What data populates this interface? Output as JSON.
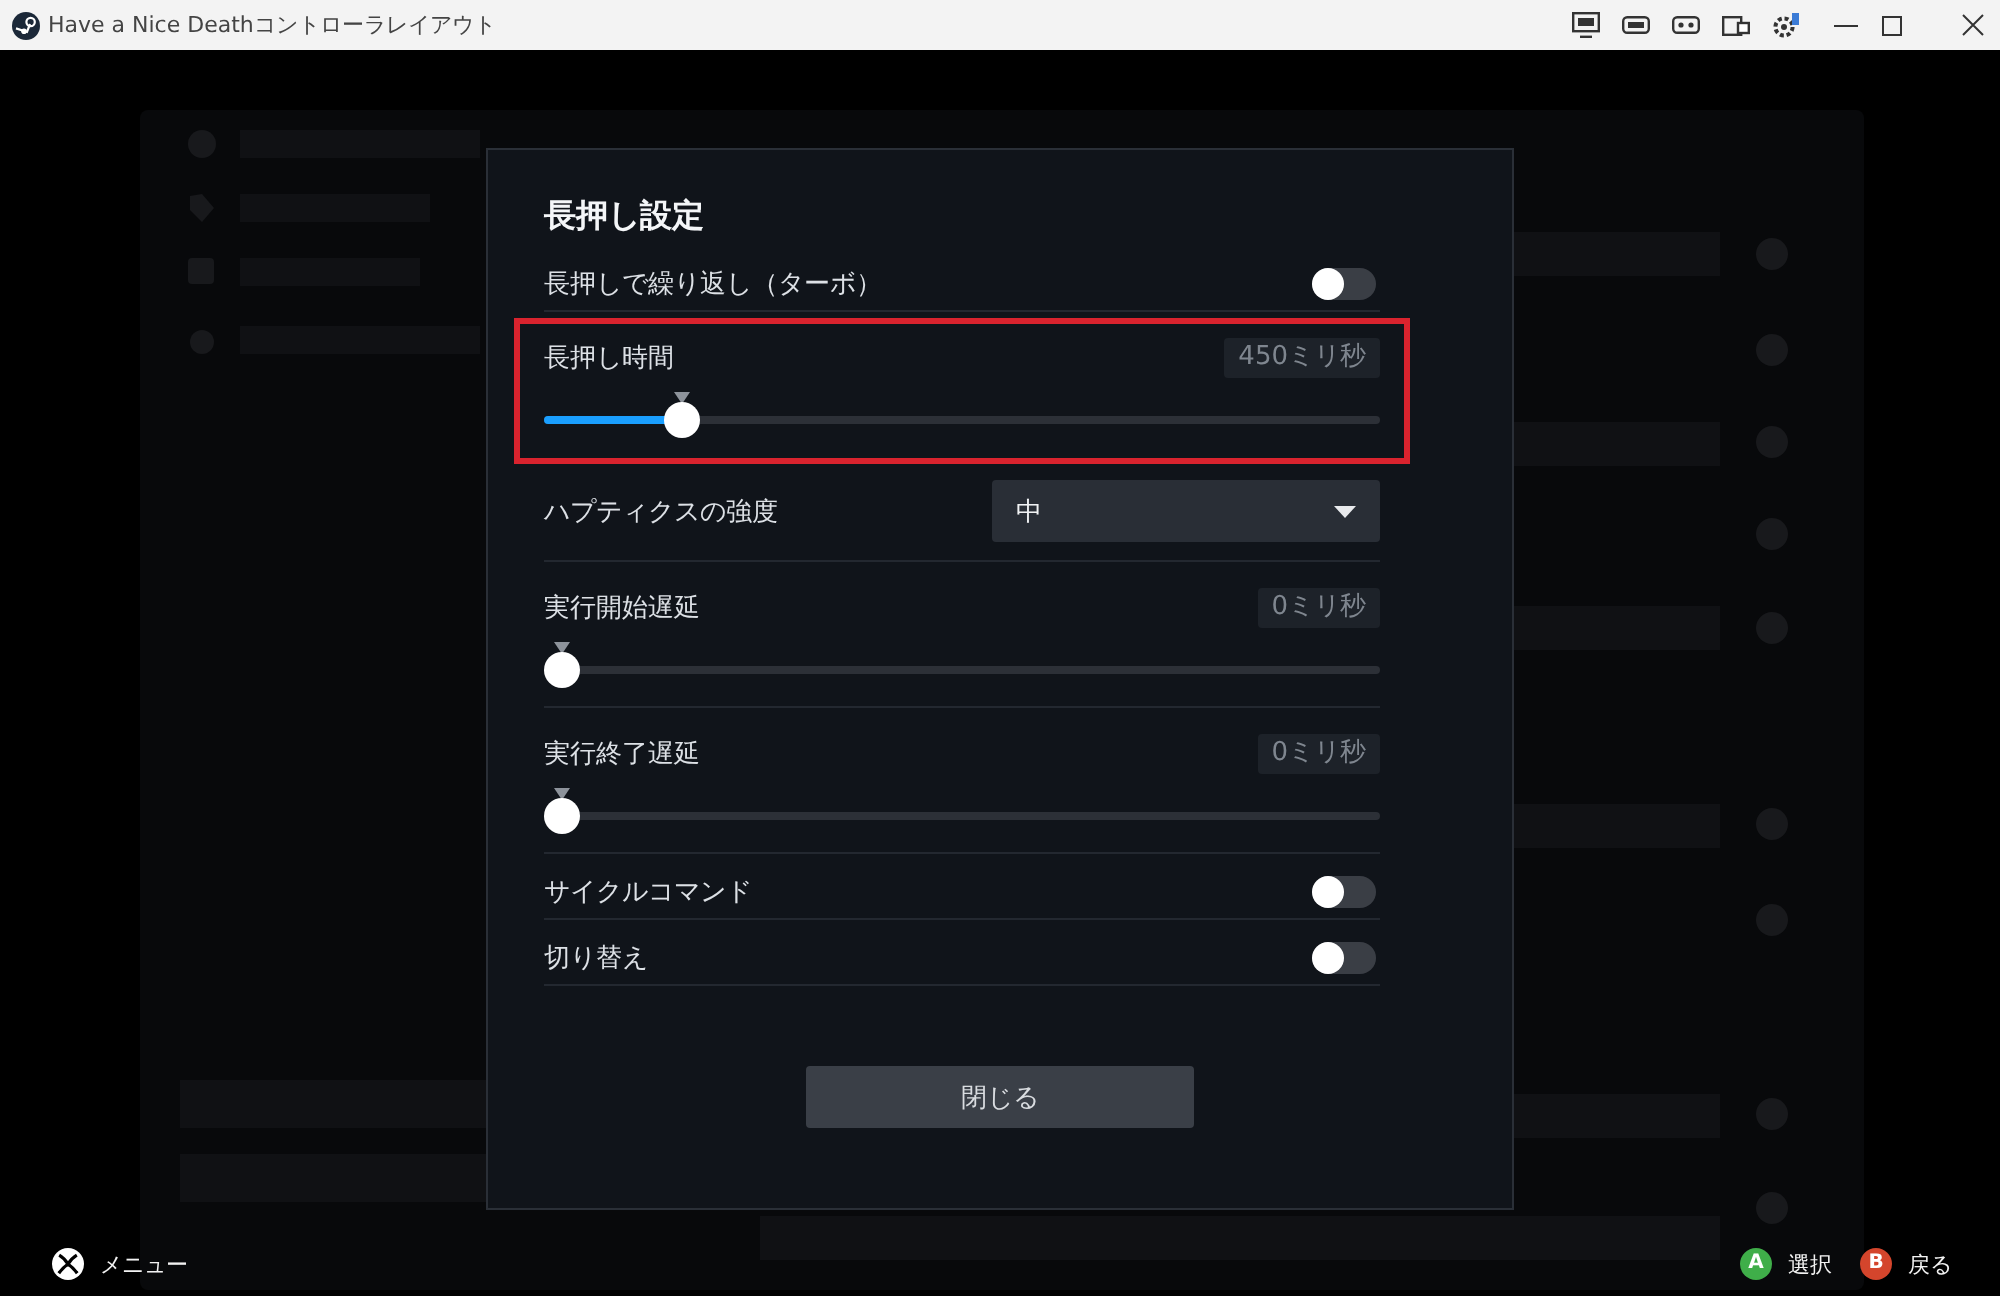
{
  "window": {
    "title": "Have a Nice Deathコントローラレイアウト"
  },
  "dialog": {
    "title": "長押し設定",
    "settings": [
      {
        "kind": "toggle",
        "label": "長押しで繰り返し（ターボ）",
        "on": false,
        "highlighted": false
      },
      {
        "kind": "slider",
        "label": "長押し時間",
        "reading": "450ミリ秒",
        "level": 0.15,
        "highlighted": true
      },
      {
        "kind": "dropdown",
        "label": "ハプティクスの強度",
        "value": "中",
        "highlighted": false
      },
      {
        "kind": "slider",
        "label": "実行開始遅延",
        "reading": "0ミリ秒",
        "level": 0,
        "highlighted": false
      },
      {
        "kind": "slider",
        "label": "実行終了遅延",
        "reading": "0ミリ秒",
        "level": 0,
        "highlighted": false
      },
      {
        "kind": "toggle",
        "label": "サイクルコマンド",
        "on": false,
        "highlighted": false
      },
      {
        "kind": "toggle",
        "label": "切り替え",
        "on": false,
        "highlighted": false
      }
    ],
    "close_button": "閉じる"
  },
  "footer": {
    "menu_label": "メニュー",
    "hints": [
      {
        "key": "A",
        "label": "選択",
        "color": "#3fae49"
      },
      {
        "key": "B",
        "label": "戻る",
        "color": "#d4452c"
      }
    ]
  }
}
